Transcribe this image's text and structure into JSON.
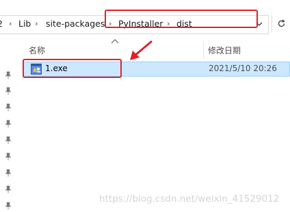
{
  "breadcrumb": {
    "items": [
      "2",
      "Lib",
      "site-packages",
      "PyInstaller",
      "dist"
    ],
    "separator": "›"
  },
  "columns": {
    "name": "名称",
    "date_modified": "修改日期"
  },
  "files": [
    {
      "name": "1.exe",
      "date_modified": "2021/5/10 20:26",
      "icon": "exe-file-icon",
      "selected": true
    }
  ],
  "watermark": "https://blog.csdn.net/weixin_41529012",
  "colors": {
    "annotation": "#e0212b",
    "selection": "#cce8ff",
    "selection_border": "#99d1ff"
  }
}
